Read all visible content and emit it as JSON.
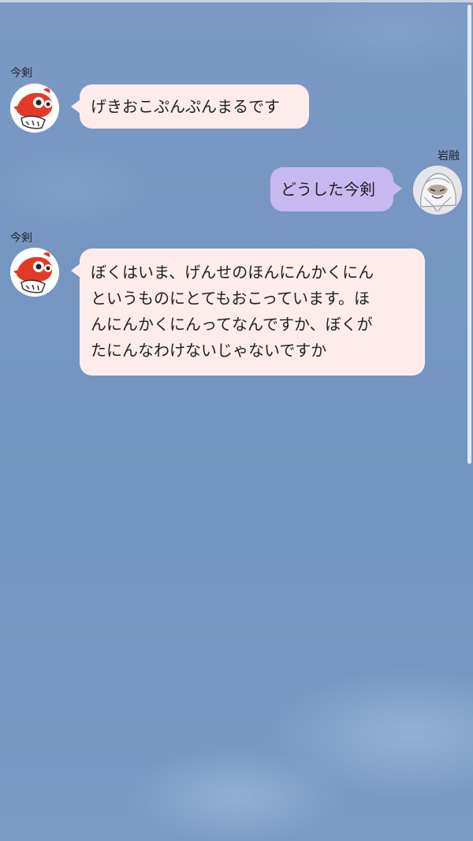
{
  "chat": {
    "messages": [
      {
        "sender": "今剣",
        "side": "left",
        "lines": [
          "げきおこぷんぷんまるです"
        ]
      },
      {
        "sender": "岩融",
        "side": "right",
        "lines": [
          "どうした今剣"
        ]
      },
      {
        "sender": "今剣",
        "side": "left",
        "lines": [
          "ぼくはいま、げんせのほんにんかくにん",
          "というものにとてもおこっています。ほ",
          "んにんかくにんってなんですか、ぼくが",
          "たにんなわけないじゃないですか"
        ]
      }
    ]
  },
  "colors": {
    "background": "#7897c2",
    "bubble_left": "#fdeceb",
    "bubble_right": "#c8b8f2"
  },
  "icons": {
    "imatsurugi_avatar": "tengu-mask-avatar",
    "iwatooshi_avatar": "white-hooded-monk-avatar"
  }
}
